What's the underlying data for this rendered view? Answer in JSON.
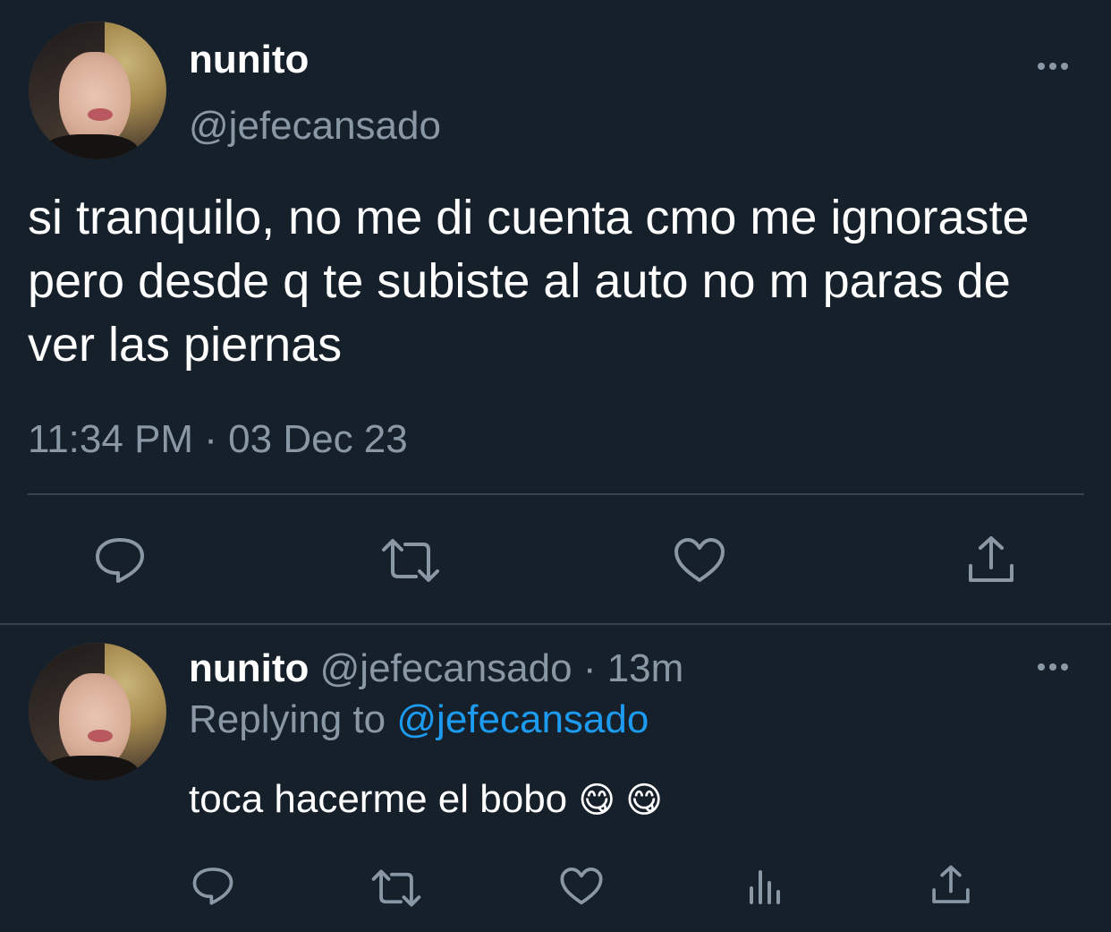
{
  "main_tweet": {
    "author_name": "nunito",
    "author_handle": "@jefecansado",
    "text": "si tranquilo, no me di cuenta cmo me ignoraste pero desde q te subiste al auto no m paras de ver las piernas",
    "timestamp": "11:34 PM · 03 Dec 23",
    "actions": [
      "reply-icon",
      "retweet-icon",
      "like-icon",
      "share-icon"
    ]
  },
  "reply_tweet": {
    "author_name": "nunito",
    "author_handle": "@jefecansado",
    "time_ago": "· 13m",
    "replying_prefix": "Replying to",
    "replying_to": "@jefecansado",
    "text": "toca hacerme el bobo",
    "emoji": "😋 😋",
    "actions": [
      "reply-icon",
      "retweet-icon",
      "like-icon",
      "analytics-icon",
      "share-icon"
    ]
  },
  "colors": {
    "background": "#16202b",
    "text_primary": "#ffffff",
    "text_muted": "#8a98a6",
    "link": "#1d9bf0",
    "divider": "#38444d"
  }
}
